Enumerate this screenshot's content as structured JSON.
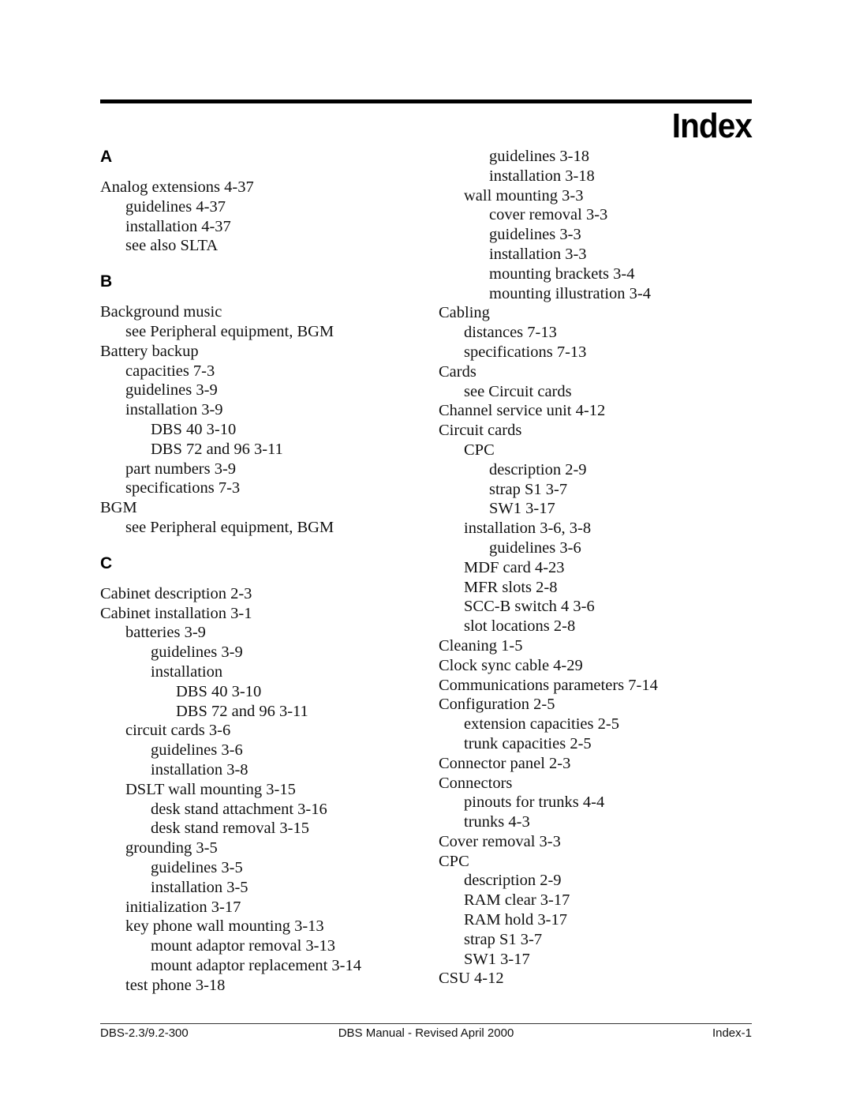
{
  "header": {
    "title": "Index"
  },
  "left_column": {
    "sections": [
      {
        "letter": "A",
        "entries": [
          {
            "level": 0,
            "text": "Analog extensions 4-37"
          },
          {
            "level": 1,
            "text": "guidelines 4-37"
          },
          {
            "level": 1,
            "text": "installation 4-37"
          },
          {
            "level": 1,
            "text": "see also SLTA"
          }
        ]
      },
      {
        "letter": "B",
        "entries": [
          {
            "level": 0,
            "text": "Background music"
          },
          {
            "level": 1,
            "text": "see Peripheral equipment, BGM"
          },
          {
            "level": 0,
            "text": "Battery backup"
          },
          {
            "level": 1,
            "text": "capacities 7-3"
          },
          {
            "level": 1,
            "text": "guidelines 3-9"
          },
          {
            "level": 1,
            "text": "installation 3-9"
          },
          {
            "level": 2,
            "text": "DBS 40 3-10"
          },
          {
            "level": 2,
            "text": "DBS 72 and 96 3-11"
          },
          {
            "level": 1,
            "text": "part numbers 3-9"
          },
          {
            "level": 1,
            "text": "specifications 7-3"
          },
          {
            "level": 0,
            "text": "BGM"
          },
          {
            "level": 1,
            "text": "see Peripheral equipment, BGM"
          }
        ]
      },
      {
        "letter": "C",
        "entries": [
          {
            "level": 0,
            "text": "Cabinet description 2-3"
          },
          {
            "level": 0,
            "text": "Cabinet installation 3-1"
          },
          {
            "level": 1,
            "text": "batteries 3-9"
          },
          {
            "level": 2,
            "text": "guidelines 3-9"
          },
          {
            "level": 2,
            "text": "installation"
          },
          {
            "level": 3,
            "text": "DBS 40 3-10"
          },
          {
            "level": 3,
            "text": "DBS 72 and 96 3-11"
          },
          {
            "level": 1,
            "text": "circuit cards 3-6"
          },
          {
            "level": 2,
            "text": "guidelines 3-6"
          },
          {
            "level": 2,
            "text": "installation 3-8"
          },
          {
            "level": 1,
            "text": "DSLT wall mounting 3-15"
          },
          {
            "level": 2,
            "text": "desk stand attachment 3-16"
          },
          {
            "level": 2,
            "text": "desk stand removal 3-15"
          },
          {
            "level": 1,
            "text": "grounding 3-5"
          },
          {
            "level": 2,
            "text": "guidelines 3-5"
          },
          {
            "level": 2,
            "text": "installation 3-5"
          },
          {
            "level": 1,
            "text": "initialization 3-17"
          },
          {
            "level": 1,
            "text": "key phone wall mounting 3-13"
          },
          {
            "level": 2,
            "text": "mount adaptor removal 3-13"
          },
          {
            "level": 2,
            "text": "mount adaptor replacement 3-14"
          },
          {
            "level": 1,
            "text": "test phone 3-18"
          }
        ]
      }
    ]
  },
  "right_column": {
    "entries": [
      {
        "level": 2,
        "text": "guidelines 3-18"
      },
      {
        "level": 2,
        "text": "installation 3-18"
      },
      {
        "level": 1,
        "text": "wall mounting 3-3"
      },
      {
        "level": 2,
        "text": "cover removal 3-3"
      },
      {
        "level": 2,
        "text": "guidelines 3-3"
      },
      {
        "level": 2,
        "text": "installation 3-3"
      },
      {
        "level": 2,
        "text": "mounting brackets 3-4"
      },
      {
        "level": 2,
        "text": "mounting illustration 3-4"
      },
      {
        "level": 0,
        "text": "Cabling"
      },
      {
        "level": 1,
        "text": "distances 7-13"
      },
      {
        "level": 1,
        "text": "specifications 7-13"
      },
      {
        "level": 0,
        "text": "Cards"
      },
      {
        "level": 1,
        "text": "see Circuit cards"
      },
      {
        "level": 0,
        "text": "Channel service unit 4-12"
      },
      {
        "level": 0,
        "text": "Circuit cards"
      },
      {
        "level": 1,
        "text": "CPC"
      },
      {
        "level": 2,
        "text": "description 2-9"
      },
      {
        "level": 2,
        "text": "strap S1 3-7"
      },
      {
        "level": 2,
        "text": "SW1 3-17"
      },
      {
        "level": 1,
        "text": "installation 3-6, 3-8"
      },
      {
        "level": 2,
        "text": "guidelines 3-6"
      },
      {
        "level": 1,
        "text": "MDF card 4-23"
      },
      {
        "level": 1,
        "text": "MFR slots 2-8"
      },
      {
        "level": 1,
        "text": "SCC-B switch 4 3-6"
      },
      {
        "level": 1,
        "text": "slot locations 2-8"
      },
      {
        "level": 0,
        "text": "Cleaning 1-5"
      },
      {
        "level": 0,
        "text": "Clock sync cable 4-29"
      },
      {
        "level": 0,
        "text": "Communications parameters 7-14"
      },
      {
        "level": 0,
        "text": "Configuration 2-5"
      },
      {
        "level": 1,
        "text": "extension capacities 2-5"
      },
      {
        "level": 1,
        "text": "trunk capacities 2-5"
      },
      {
        "level": 0,
        "text": "Connector panel 2-3"
      },
      {
        "level": 0,
        "text": "Connectors"
      },
      {
        "level": 1,
        "text": "pinouts for trunks 4-4"
      },
      {
        "level": 1,
        "text": "trunks 4-3"
      },
      {
        "level": 0,
        "text": "Cover removal 3-3"
      },
      {
        "level": 0,
        "text": "CPC"
      },
      {
        "level": 1,
        "text": "description 2-9"
      },
      {
        "level": 1,
        "text": "RAM clear 3-17"
      },
      {
        "level": 1,
        "text": "RAM hold 3-17"
      },
      {
        "level": 1,
        "text": "strap S1 3-7"
      },
      {
        "level": 1,
        "text": "SW1 3-17"
      },
      {
        "level": 0,
        "text": "CSU 4-12"
      }
    ]
  },
  "footer": {
    "doc_number": "DBS-2.3/9.2-300",
    "manual_title": "DBS Manual - Revised April 2000",
    "page_number": "Index-1"
  }
}
